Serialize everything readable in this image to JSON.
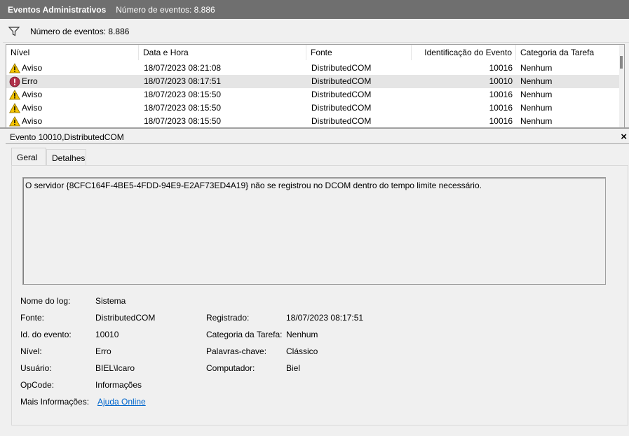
{
  "titlebar": {
    "title": "Eventos Administrativos",
    "count": "Número de eventos: 8.886"
  },
  "filterbar": {
    "count": "Número de eventos: 8.886",
    "icon": "filter-icon"
  },
  "list": {
    "columns": [
      "Nível",
      "Data e Hora",
      "Fonte",
      "Identificação do Evento",
      "Categoria da Tarefa"
    ],
    "rows": [
      {
        "level": "Aviso",
        "icon": "warning-icon",
        "date": "18/07/2023 08:21:08",
        "source": "DistributedCOM",
        "id": "10016",
        "category": "Nenhum"
      },
      {
        "level": "Erro",
        "icon": "error-icon",
        "date": "18/07/2023 08:17:51",
        "source": "DistributedCOM",
        "id": "10010",
        "category": "Nenhum"
      },
      {
        "level": "Aviso",
        "icon": "warning-icon",
        "date": "18/07/2023 08:15:50",
        "source": "DistributedCOM",
        "id": "10016",
        "category": "Nenhum"
      },
      {
        "level": "Aviso",
        "icon": "warning-icon",
        "date": "18/07/2023 08:15:50",
        "source": "DistributedCOM",
        "id": "10016",
        "category": "Nenhum"
      },
      {
        "level": "Aviso",
        "icon": "warning-icon",
        "date": "18/07/2023 08:15:50",
        "source": "DistributedCOM",
        "id": "10016",
        "category": "Nenhum"
      }
    ]
  },
  "detail": {
    "header": "Evento 10010,DistributedCOM",
    "close": "×",
    "tabs": [
      "Geral",
      "Detalhes"
    ],
    "message": "O servidor {8CFC164F-4BE5-4FDD-94E9-E2AF73ED4A19} não se registrou no DCOM dentro do tempo limite necessário.",
    "labels": {
      "log_name": "Nome do log:",
      "source": "Fonte:",
      "event_id": "Id. do evento:",
      "level": "Nível:",
      "user": "Usuário:",
      "opcode": "OpCode:",
      "more_info": "Mais Informações:",
      "logged": "Registrado:",
      "task_category": "Categoria da Tarefa:",
      "keywords": "Palavras-chave:",
      "computer": "Computador:"
    },
    "values": {
      "log_name": "Sistema",
      "source": "DistributedCOM",
      "event_id": "10010",
      "level": "Erro",
      "user": "BIEL\\Icaro",
      "opcode": "Informações",
      "more_info": "Ajuda Online",
      "logged": "18/07/2023 08:17:51",
      "task_category": "Nenhum",
      "keywords": "Clássico",
      "computer": "Biel"
    }
  },
  "colors": {
    "titlebar": "#6f6f6f",
    "selected_row": "#e5e5e5",
    "link": "#0066cc",
    "warning": "#f5c400",
    "error": "#b0304a"
  }
}
